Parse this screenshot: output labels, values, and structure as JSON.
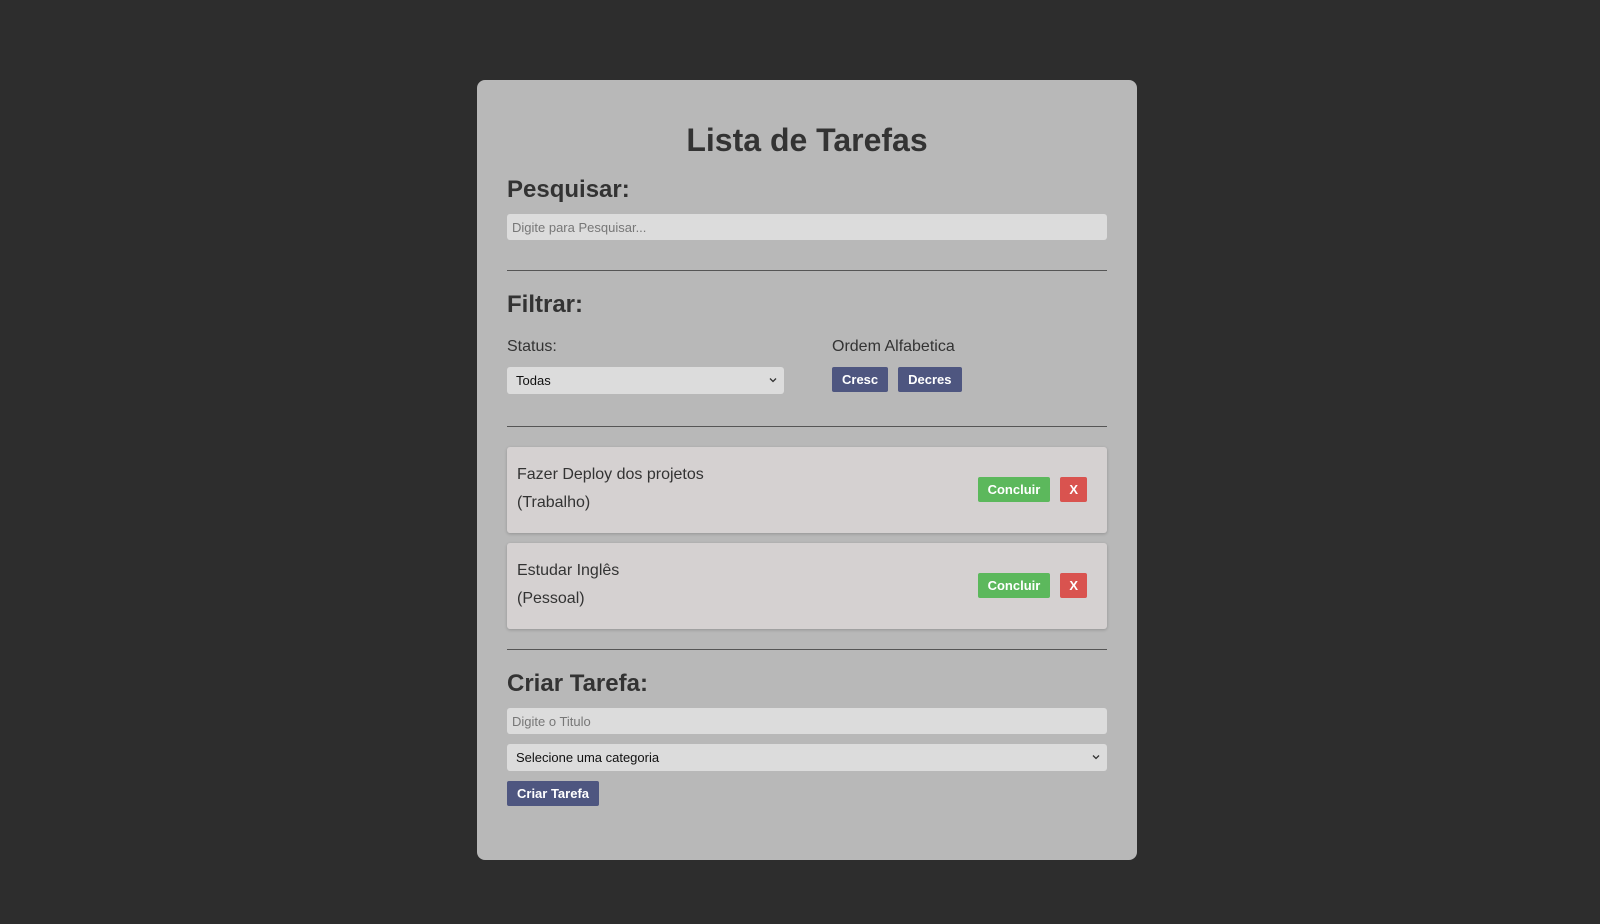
{
  "app": {
    "title": "Lista de Tarefas"
  },
  "search": {
    "heading": "Pesquisar:",
    "placeholder": "Digite para Pesquisar...",
    "value": ""
  },
  "filter": {
    "heading": "Filtrar:",
    "status_label": "Status:",
    "status_selected": "Todas",
    "order_label": "Ordem Alfabetica",
    "asc_label": "Cresc",
    "desc_label": "Decres"
  },
  "tasks": [
    {
      "title": "Fazer Deploy dos projetos",
      "category": "(Trabalho)",
      "complete_label": "Concluir",
      "delete_label": "X"
    },
    {
      "title": "Estudar Inglês",
      "category": "(Pessoal)",
      "complete_label": "Concluir",
      "delete_label": "X"
    }
  ],
  "create": {
    "heading": "Criar Tarefa:",
    "title_placeholder": "Digite o Titulo",
    "category_selected": "Selecione uma categoria",
    "submit_label": "Criar Tarefa"
  },
  "colors": {
    "page_background": "#2d2d2d",
    "panel_background": "#b8b8b8",
    "primary_button": "#4e5680",
    "success_button": "#5cb85c",
    "danger_button": "#d9534f",
    "task_card": "#d5d1d1"
  },
  "icons": {
    "select_arrow": "chevron-down-icon"
  }
}
